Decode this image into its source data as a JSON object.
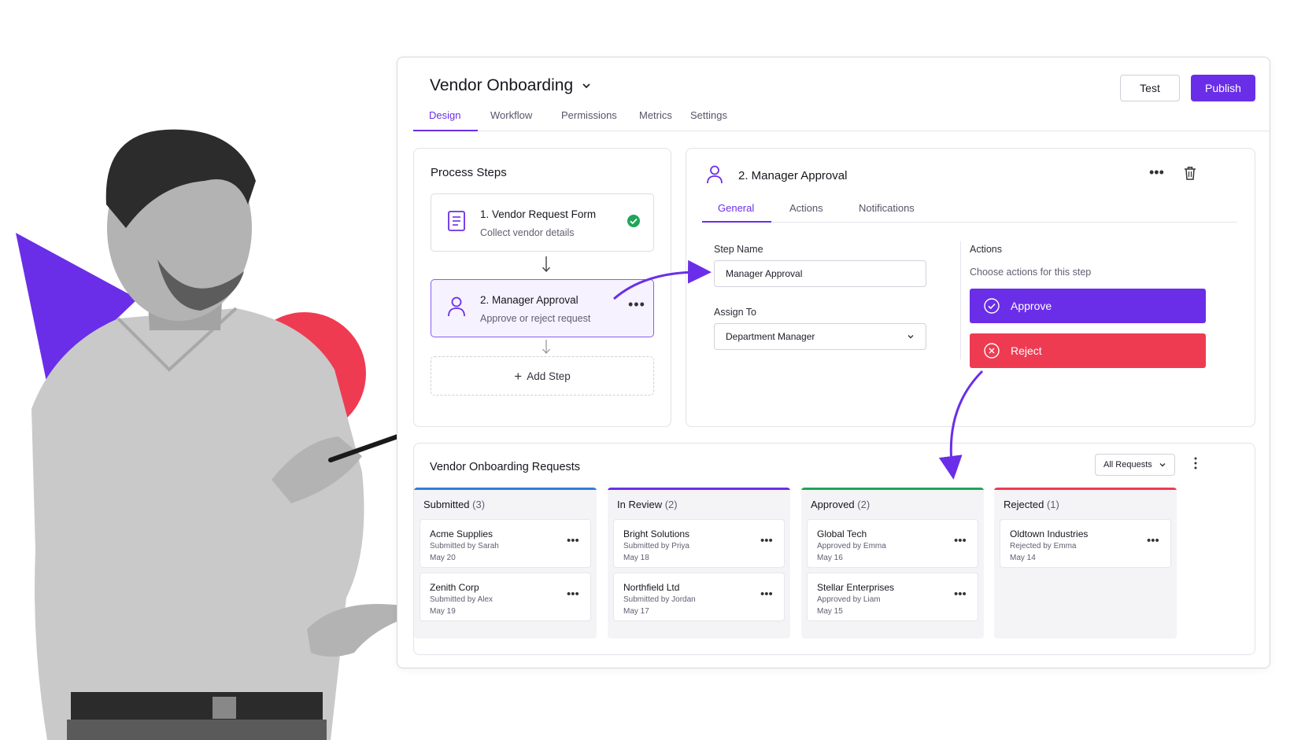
{
  "app": {
    "title": "Vendor Onboarding",
    "test_label": "Test",
    "publish_label": "Publish",
    "tabs": [
      {
        "label": "Design",
        "active": true
      },
      {
        "label": "Workflow",
        "active": false
      },
      {
        "label": "Permissions",
        "active": false
      },
      {
        "label": "Metrics",
        "active": false
      },
      {
        "label": "Settings",
        "active": false
      }
    ]
  },
  "steps_panel": {
    "title": "Process Steps",
    "steps": [
      {
        "title": "1. Vendor Request Form",
        "subtitle": "Collect vendor details",
        "icon": "form-icon",
        "status": "complete"
      },
      {
        "title": "2. Manager Approval",
        "subtitle": "Approve or reject request",
        "icon": "user-icon",
        "status": "selected"
      }
    ],
    "add_step_label": "Add Step"
  },
  "detail_panel": {
    "title": "2. Manager Approval",
    "tabs": [
      {
        "label": "General",
        "active": true
      },
      {
        "label": "Actions",
        "active": false
      },
      {
        "label": "Notifications",
        "active": false
      }
    ],
    "step_name_label": "Step Name",
    "step_name_value": "Manager Approval",
    "assign_to_label": "Assign To",
    "assign_to_value": "Department Manager",
    "actions_label": "Actions",
    "actions_hint": "Choose actions for this step",
    "approve_label": "Approve",
    "reject_label": "Reject"
  },
  "board": {
    "title": "Vendor Onboarding Requests",
    "filter_value": "All Requests",
    "columns": [
      {
        "name": "Submitted",
        "count": "(3)",
        "color": "#2f7fd8",
        "cards": [
          {
            "name": "Acme Supplies",
            "by": "Submitted by Sarah",
            "date": "May 20"
          },
          {
            "name": "Zenith Corp",
            "by": "Submitted by Alex",
            "date": "May 19"
          }
        ]
      },
      {
        "name": "In Review",
        "count": "(2)",
        "color": "#6a2ee8",
        "cards": [
          {
            "name": "Bright Solutions",
            "by": "Submitted by Priya",
            "date": "May 18"
          },
          {
            "name": "Northfield Ltd",
            "by": "Submitted by Jordan",
            "date": "May 17"
          }
        ]
      },
      {
        "name": "Approved",
        "count": "(2)",
        "color": "#1fa55a",
        "cards": [
          {
            "name": "Global Tech",
            "by": "Approved by Emma",
            "date": "May 16"
          },
          {
            "name": "Stellar Enterprises",
            "by": "Approved by Liam",
            "date": "May 15"
          }
        ]
      },
      {
        "name": "Rejected",
        "count": "(1)",
        "color": "#ee3b52",
        "cards": [
          {
            "name": "Oldtown Industries",
            "by": "Rejected by Emma",
            "date": "May 14"
          }
        ]
      }
    ]
  },
  "colors": {
    "accent": "#6a2ee8",
    "danger": "#ee3b52",
    "success": "#1fa55a"
  }
}
